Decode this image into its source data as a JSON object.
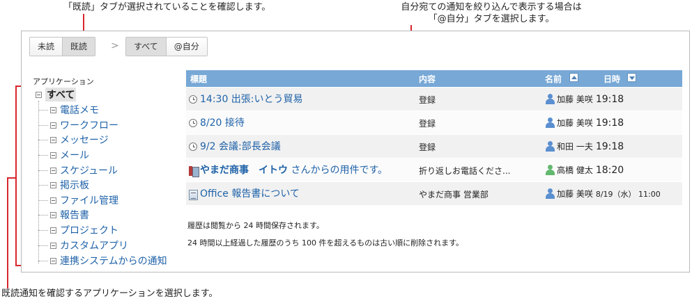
{
  "callouts": {
    "tab_read": "「既読」タブが選択されていることを確認します。",
    "tab_self_line1": "自分宛ての通知を絞り込んで表示する場合は",
    "tab_self_line2": "「@自分」タブを選択します。",
    "app_select": "既読通知を確認するアプリケーションを選択します。"
  },
  "tabs_status": [
    {
      "label": "未読",
      "selected": false
    },
    {
      "label": "既読",
      "selected": true
    }
  ],
  "tabs_scope": [
    {
      "label": "すべて",
      "selected": true
    },
    {
      "label": "@自分",
      "selected": false
    }
  ],
  "breadcrumb_separator": ">",
  "sidebar": {
    "title": "アプリケーション",
    "root": "すべて",
    "items": [
      "電話メモ",
      "ワークフロー",
      "メッセージ",
      "メール",
      "スケジュール",
      "掲示板",
      "ファイル管理",
      "報告書",
      "プロジェクト",
      "カスタムアプリ",
      "連携システムからの通知"
    ]
  },
  "table": {
    "headers": {
      "title": "標題",
      "content": "内容",
      "name": "名前",
      "datetime": "日時"
    },
    "rows": [
      {
        "icon": "clock-icon",
        "title": "14:30 出張:いとう貿易",
        "title_bold": "",
        "content": "登録",
        "user": "加藤 美咲",
        "user_color": "blue",
        "time": "19:18"
      },
      {
        "icon": "clock-icon",
        "title": "8/20 接待",
        "title_bold": "",
        "content": "登録",
        "user": "加藤 美咲",
        "user_color": "blue",
        "time": "19:18"
      },
      {
        "icon": "clock-icon",
        "title": "9/2 会議:部長会議",
        "title_bold": "",
        "content": "登録",
        "user": "和田 一夫",
        "user_color": "blue",
        "time": "19:18"
      },
      {
        "icon": "phone-memo-icon",
        "title": " さんからの用件です。",
        "title_bold": "やまだ商事　イトウ",
        "content": "折り返しお電話くださ...",
        "user": "高橋 健太",
        "user_color": "green",
        "time": "18:20"
      },
      {
        "icon": "report-icon",
        "title": "Office 報告書について",
        "title_bold": "",
        "content": "やまだ商事 営業部",
        "user": "加藤 美咲",
        "user_color": "blue",
        "time": "8/19（水） 11:00"
      }
    ]
  },
  "notes": [
    "履歴は閲覧から 24 時間保存されます。",
    "24 時間以上経過した履歴のうち 100 件を超えるものは古い順に削除されます。"
  ],
  "colors": {
    "accent_red": "#d8262e",
    "header_blue": "#77a8d6",
    "link_blue": "#1f62a8"
  }
}
